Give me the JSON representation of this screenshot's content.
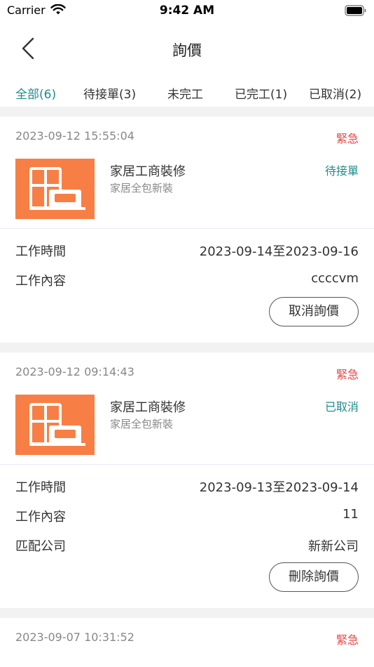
{
  "status_bar": {
    "carrier": "Carrier",
    "time": "9:42 AM"
  },
  "nav": {
    "title": "詢價"
  },
  "tabs": [
    {
      "label": "全部(6)",
      "active": true
    },
    {
      "label": "待接單(3)",
      "active": false
    },
    {
      "label": "未完工",
      "active": false
    },
    {
      "label": "已完工(1)",
      "active": false
    },
    {
      "label": "已取消(2)",
      "active": false
    }
  ],
  "colors": {
    "accent": "#1e8c8c",
    "urgent": "#e64545",
    "thumb": "#f77f45"
  },
  "orders": [
    {
      "timestamp": "2023-09-12 15:55:04",
      "urgency": "緊急",
      "title": "家居工商裝修",
      "subtitle": "家居全包新裝",
      "status": "待接單",
      "icon": "home-furniture-icon",
      "rows": [
        {
          "label": "工作時間",
          "value": "2023-09-14至2023-09-16"
        },
        {
          "label": "工作內容",
          "value": "ccccvm"
        }
      ],
      "action": "取消詢價"
    },
    {
      "timestamp": "2023-09-12 09:14:43",
      "urgency": "緊急",
      "title": "家居工商裝修",
      "subtitle": "家居全包新裝",
      "status": "已取消",
      "icon": "home-furniture-icon",
      "rows": [
        {
          "label": "工作時間",
          "value": "2023-09-13至2023-09-14"
        },
        {
          "label": "工作內容",
          "value": "11"
        },
        {
          "label": "匹配公司",
          "value": "新新公司"
        }
      ],
      "action": "刪除詢價"
    },
    {
      "timestamp": "2023-09-07 10:31:52",
      "urgency": "緊急"
    }
  ]
}
